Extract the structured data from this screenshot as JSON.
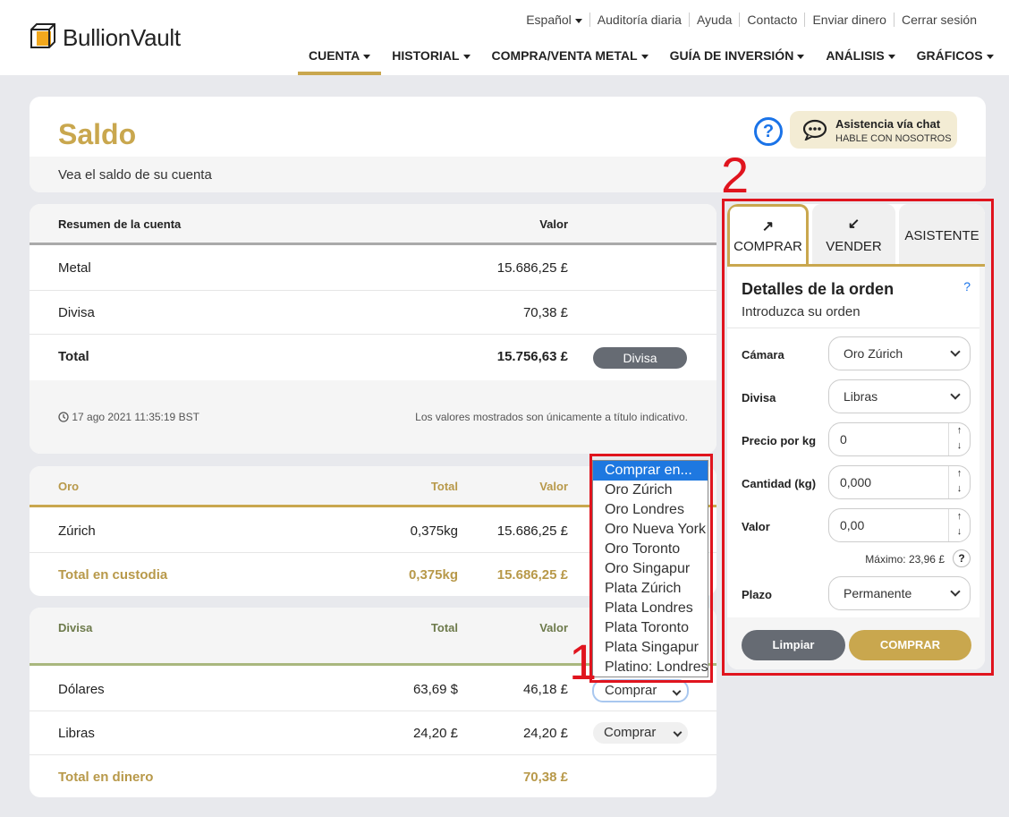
{
  "brand": {
    "name": "BullionVault"
  },
  "toplinks": [
    "Español",
    "Auditoría diaria",
    "Ayuda",
    "Contacto",
    "Enviar dinero",
    "Cerrar sesión"
  ],
  "nav": [
    "CUENTA",
    "HISTORIAL",
    "COMPRA/VENTA METAL",
    "GUÍA DE INVERSIÓN",
    "ANÁLISIS",
    "GRÁFICOS"
  ],
  "page": {
    "title": "Saldo",
    "subtitle": "Vea el saldo de su cuenta"
  },
  "chat": {
    "title": "Asistencia vía chat",
    "subtitle": "HABLE CON NOSOTROS"
  },
  "summary": {
    "header_label": "Resumen de la cuenta",
    "header_value": "Valor",
    "rows": [
      {
        "label": "Metal",
        "value": "15.686,25 £"
      },
      {
        "label": "Divisa",
        "value": "70,38 £"
      },
      {
        "label": "Total",
        "value": "15.756,63 £"
      }
    ],
    "divisa_button": "Divisa",
    "timestamp": "17 ago 2021 11:35:19 BST",
    "note": "Los valores mostrados son únicamente a título indicativo."
  },
  "gold": {
    "header": {
      "label": "Oro",
      "total": "Total",
      "value": "Valor"
    },
    "rows": [
      {
        "label": "Zúrich",
        "total": "0,375kg",
        "value": "15.686,25 £"
      }
    ],
    "footer": {
      "label": "Total en custodia",
      "total": "0,375kg",
      "value": "15.686,25 £"
    }
  },
  "currency": {
    "header": {
      "label": "Divisa",
      "total": "Total",
      "value": "Valor"
    },
    "rows": [
      {
        "label": "Dólares",
        "total": "63,69 $",
        "value": "46,18 £",
        "action": "Comprar"
      },
      {
        "label": "Libras",
        "total": "24,20 £",
        "value": "24,20 £",
        "action": "Comprar"
      }
    ],
    "footer": {
      "label": "Total en dinero",
      "value": "70,38 £"
    }
  },
  "dropdown": {
    "options": [
      "Comprar en...",
      "Oro Zúrich",
      "Oro Londres",
      "Oro Nueva York",
      "Oro Toronto",
      "Oro Singapur",
      "Plata Zúrich",
      "Plata Londres",
      "Plata Toronto",
      "Plata Singapur",
      "Platino: Londres"
    ],
    "selected_index": 0
  },
  "annotations": {
    "one": "1",
    "two": "2"
  },
  "order": {
    "tabs": [
      {
        "label": "COMPRAR",
        "icon": "↗"
      },
      {
        "label": "VENDER",
        "icon": "↙"
      },
      {
        "label": "ASISTENTE",
        "icon": ""
      }
    ],
    "title": "Detalles de la orden",
    "subtitle": "Introduzca su orden",
    "help": "?",
    "fields": {
      "camara": {
        "label": "Cámara",
        "value": "Oro Zúrich"
      },
      "divisa": {
        "label": "Divisa",
        "value": "Libras"
      },
      "precio": {
        "label": "Precio por kg",
        "value": "0"
      },
      "cantidad": {
        "label": "Cantidad (kg)",
        "value": "0,000"
      },
      "valor": {
        "label": "Valor",
        "value": "0,00"
      },
      "plazo": {
        "label": "Plazo",
        "value": "Permanente"
      }
    },
    "max_note": "Máximo: 23,96 £",
    "clear_label": "Limpiar",
    "buy_label": "COMPRAR"
  },
  "colors": {
    "gold": "#c9a74e",
    "link_blue": "#1a73e8",
    "annotation_red": "#e0141e"
  }
}
